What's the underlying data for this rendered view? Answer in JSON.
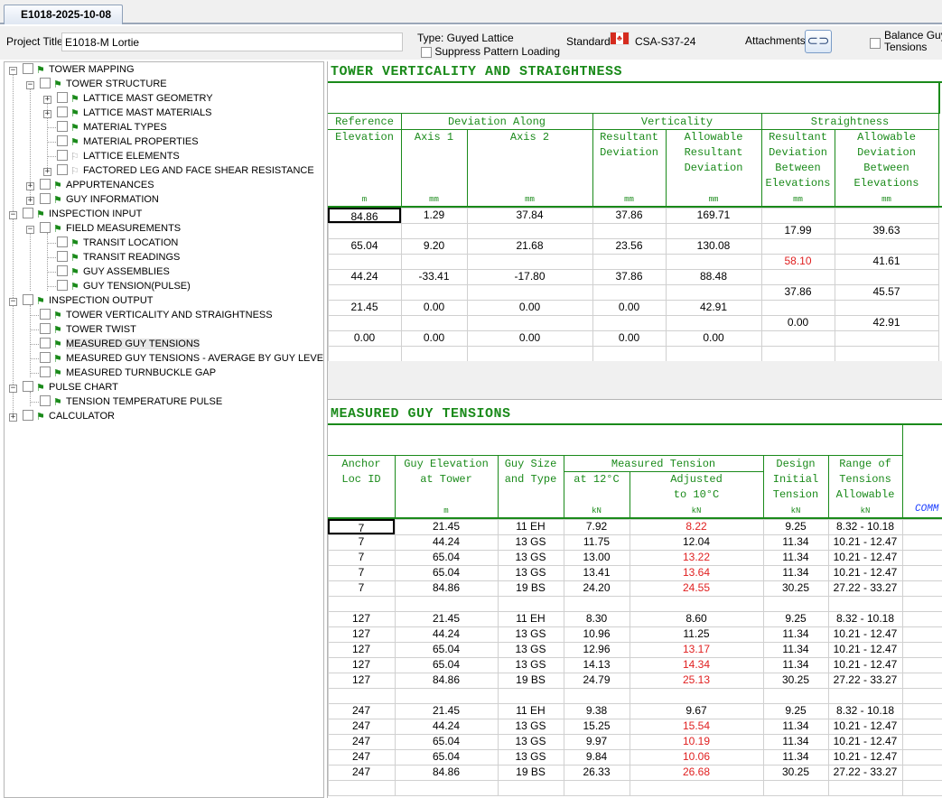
{
  "document_tab": "E1018-2025-10-08",
  "header": {
    "project_title_label": "Project Title:",
    "project_title_value": "E1018-M Lortie",
    "type_label": "Type: Guyed Lattice",
    "suppress_label": "Suppress Pattern Loading",
    "standard_label": "Standard:",
    "standard_value": "CSA-S37-24",
    "attachments_label": "Attachments:",
    "balance_label_1": "Balance Guy",
    "balance_label_2": "Tensions"
  },
  "tree": {
    "tower_mapping": "TOWER MAPPING",
    "tower_structure": "TOWER STRUCTURE",
    "lattice_mast_geometry": "LATTICE MAST GEOMETRY",
    "lattice_mast_materials": "LATTICE MAST MATERIALS",
    "material_types": "MATERIAL TYPES",
    "material_properties": "MATERIAL PROPERTIES",
    "lattice_elements": "LATTICE ELEMENTS",
    "factored_leg": "FACTORED LEG AND FACE SHEAR RESISTANCE",
    "appurtenances": "APPURTENANCES",
    "guy_information": "GUY INFORMATION",
    "inspection_input": "INSPECTION INPUT",
    "field_measurements": "FIELD MEASUREMENTS",
    "transit_location": "TRANSIT LOCATION",
    "transit_readings": "TRANSIT READINGS",
    "guy_assemblies": "GUY ASSEMBLIES",
    "guy_tension_pulse": "GUY TENSION(PULSE)",
    "inspection_output": "INSPECTION OUTPUT",
    "tower_verticality": "TOWER VERTICALITY AND STRAIGHTNESS",
    "tower_twist": "TOWER TWIST",
    "measured_guy_tensions": "MEASURED GUY TENSIONS",
    "measured_avg": "MEASURED GUY TENSIONS - AVERAGE BY GUY LEVEL",
    "turnbuckle_gap": "MEASURED TURNBUCKLE GAP",
    "pulse_chart": "PULSE CHART",
    "tension_temp_pulse": "TENSION TEMPERATURE PULSE",
    "calculator": "CALCULATOR"
  },
  "verticality": {
    "title": "TOWER VERTICALITY AND STRAIGHTNESS",
    "h_reference": "Reference\nElevation",
    "h_deviation_along": "Deviation Along",
    "h_axis1": "Axis 1",
    "h_axis2": "Axis 2",
    "h_verticality": "Verticality",
    "h_resultant_dev": "Resultant\nDeviation",
    "h_allowable_res": "Allowable\nResultant\nDeviation",
    "h_straightness": "Straightness",
    "h_res_between": "Resultant\nDeviation\nBetween\nElevations",
    "h_allow_between": "Allowable\nDeviation\nBetween\nElevations",
    "u_m": "m",
    "u_mm": "mm",
    "rows": [
      {
        "elev": "84.86",
        "a1": "1.29",
        "a2": "37.84",
        "res": "37.86",
        "allow": "169.71"
      },
      {
        "elev": "65.04",
        "a1": "9.20",
        "a2": "21.68",
        "res": "23.56",
        "allow": "130.08"
      },
      {
        "elev": "44.24",
        "a1": "-33.41",
        "a2": "-17.80",
        "res": "37.86",
        "allow": "88.48"
      },
      {
        "elev": "21.45",
        "a1": "0.00",
        "a2": "0.00",
        "res": "0.00",
        "allow": "42.91"
      },
      {
        "elev": "0.00",
        "a1": "0.00",
        "a2": "0.00",
        "res": "0.00",
        "allow": "0.00"
      }
    ],
    "between": [
      {
        "res": "17.99",
        "allow": "39.63",
        "red": false
      },
      {
        "res": "58.10",
        "allow": "41.61",
        "red": true
      },
      {
        "res": "37.86",
        "allow": "45.57",
        "red": false
      },
      {
        "res": "0.00",
        "allow": "42.91",
        "red": false
      }
    ]
  },
  "guy": {
    "title": "MEASURED GUY TENSIONS",
    "h_anchor": "Anchor\nLoc ID",
    "h_elev": "Guy Elevation\nat Tower",
    "h_size": "Guy Size\nand Type",
    "h_measured": "Measured Tension",
    "h_at12": "at 12°C",
    "h_adjusted": "Adjusted\nto 10°C",
    "h_design": "Design\nInitial\nTension",
    "h_range": "Range of\nTensions\nAllowable",
    "u_m": "m",
    "u_kn": "kN",
    "comment_partial": "COMM",
    "groups": [
      {
        "rows": [
          {
            "id": "7",
            "elev": "21.45",
            "size": "11 EH",
            "t12": "7.92",
            "adj": "8.22",
            "red": true,
            "design": "9.25",
            "range": "8.32 - 10.18"
          },
          {
            "id": "7",
            "elev": "44.24",
            "size": "13 GS",
            "t12": "11.75",
            "adj": "12.04",
            "red": false,
            "design": "11.34",
            "range": "10.21 - 12.47"
          },
          {
            "id": "7",
            "elev": "65.04",
            "size": "13 GS",
            "t12": "13.00",
            "adj": "13.22",
            "red": true,
            "design": "11.34",
            "range": "10.21 - 12.47"
          },
          {
            "id": "7",
            "elev": "65.04",
            "size": "13 GS",
            "t12": "13.41",
            "adj": "13.64",
            "red": true,
            "design": "11.34",
            "range": "10.21 - 12.47"
          },
          {
            "id": "7",
            "elev": "84.86",
            "size": "19 BS",
            "t12": "24.20",
            "adj": "24.55",
            "red": true,
            "design": "30.25",
            "range": "27.22 - 33.27"
          }
        ]
      },
      {
        "rows": [
          {
            "id": "127",
            "elev": "21.45",
            "size": "11 EH",
            "t12": "8.30",
            "adj": "8.60",
            "red": false,
            "design": "9.25",
            "range": "8.32 - 10.18"
          },
          {
            "id": "127",
            "elev": "44.24",
            "size": "13 GS",
            "t12": "10.96",
            "adj": "11.25",
            "red": false,
            "design": "11.34",
            "range": "10.21 - 12.47"
          },
          {
            "id": "127",
            "elev": "65.04",
            "size": "13 GS",
            "t12": "12.96",
            "adj": "13.17",
            "red": true,
            "design": "11.34",
            "range": "10.21 - 12.47"
          },
          {
            "id": "127",
            "elev": "65.04",
            "size": "13 GS",
            "t12": "14.13",
            "adj": "14.34",
            "red": true,
            "design": "11.34",
            "range": "10.21 - 12.47"
          },
          {
            "id": "127",
            "elev": "84.86",
            "size": "19 BS",
            "t12": "24.79",
            "adj": "25.13",
            "red": true,
            "design": "30.25",
            "range": "27.22 - 33.27"
          }
        ]
      },
      {
        "rows": [
          {
            "id": "247",
            "elev": "21.45",
            "size": "11 EH",
            "t12": "9.38",
            "adj": "9.67",
            "red": false,
            "design": "9.25",
            "range": "8.32 - 10.18"
          },
          {
            "id": "247",
            "elev": "44.24",
            "size": "13 GS",
            "t12": "15.25",
            "adj": "15.54",
            "red": true,
            "design": "11.34",
            "range": "10.21 - 12.47"
          },
          {
            "id": "247",
            "elev": "65.04",
            "size": "13 GS",
            "t12": "9.97",
            "adj": "10.19",
            "red": true,
            "design": "11.34",
            "range": "10.21 - 12.47"
          },
          {
            "id": "247",
            "elev": "65.04",
            "size": "13 GS",
            "t12": "9.84",
            "adj": "10.06",
            "red": true,
            "design": "11.34",
            "range": "10.21 - 12.47"
          },
          {
            "id": "247",
            "elev": "84.86",
            "size": "19 BS",
            "t12": "26.33",
            "adj": "26.68",
            "red": true,
            "design": "30.25",
            "range": "27.22 - 33.27"
          }
        ]
      }
    ]
  },
  "colors": {
    "accent_green": "#1a8a1a",
    "warning_red": "#e02020",
    "flag_red": "#d52b1e"
  }
}
